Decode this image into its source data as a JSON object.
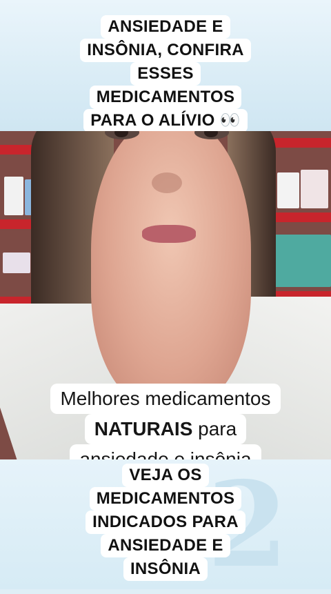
{
  "top_caption": {
    "lines": [
      "ANSIEDADE E",
      "INSÔNIA, CONFIRA",
      "ESSES",
      "MEDICAMENTOS",
      "PARA O ALÍVIO 👀"
    ]
  },
  "video_caption": {
    "line1": "Melhores medicamentos",
    "line2_bold": "NATURAIS",
    "line2_rest": " para",
    "line3": "ansiedade e insônia"
  },
  "bottom_caption": {
    "lines": [
      "VEJA OS",
      "MEDICAMENTOS",
      "INDICADOS PARA",
      "ANSIEDADE E",
      "INSÔNIA"
    ]
  },
  "colors": {
    "shelf_red": "#c8252c",
    "caption_bg": "#ffffff",
    "band_blue": "#dfeef6"
  }
}
